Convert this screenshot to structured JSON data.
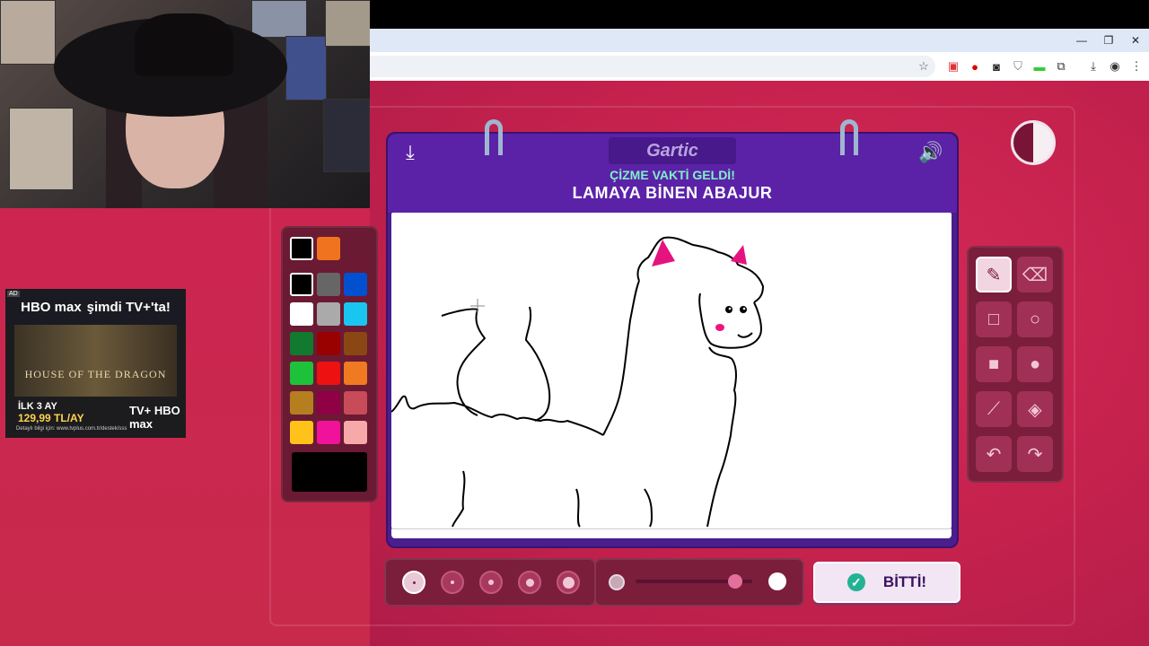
{
  "browser": {
    "window_controls": [
      "—",
      "❐",
      "✕"
    ],
    "toolbar_icons": [
      "star-icon",
      "extension-youtube-icon",
      "extension-red-icon",
      "extension-dark-icon",
      "extension-shield-icon",
      "extension-green-icon",
      "extensions-puzzle-icon",
      "download-icon",
      "profile-icon",
      "menu-icon"
    ]
  },
  "ad": {
    "badge": "AD",
    "brand": "HBO max",
    "headline": "şimdi TV+'ta!",
    "show_title": "HOUSE OF THE DRAGON",
    "offer_line1": "İLK 3 AY",
    "offer_line2": "129,99 TL/AY",
    "logo": "TV+ HBO max",
    "fine_print": "Detaylı bilgi için: www.tvplus.com.tr/destek/sss"
  },
  "game": {
    "logo": "Gartic",
    "hint": "ÇİZME VAKTİ GELDİ!",
    "word": "LAMAYA BİNEN ABAJUR",
    "done_label": "BİTTİ!",
    "timer_fraction_remaining": 0.5,
    "opacity_level": 0.85,
    "selected_size_index": 0,
    "selected_tool": "pencil",
    "colors": {
      "recent": [
        "#000000",
        "#f0731f"
      ],
      "grid": [
        "#000000",
        "#666666",
        "#0050d0",
        "#ffffff",
        "#aaaaaa",
        "#19c6f0",
        "#117a2e",
        "#990000",
        "#8a4714",
        "#1ec23a",
        "#ee1111",
        "#f07a22",
        "#b57f1f",
        "#900045",
        "#c84b5a",
        "#ffc21a",
        "#f0129a",
        "#f7a8a8"
      ],
      "current": "#000000"
    },
    "tools": [
      "pencil",
      "eraser",
      "rectangle-outline",
      "circle-outline",
      "rectangle-filled",
      "circle-filled",
      "line",
      "fill-bucket",
      "undo",
      "redo"
    ]
  }
}
